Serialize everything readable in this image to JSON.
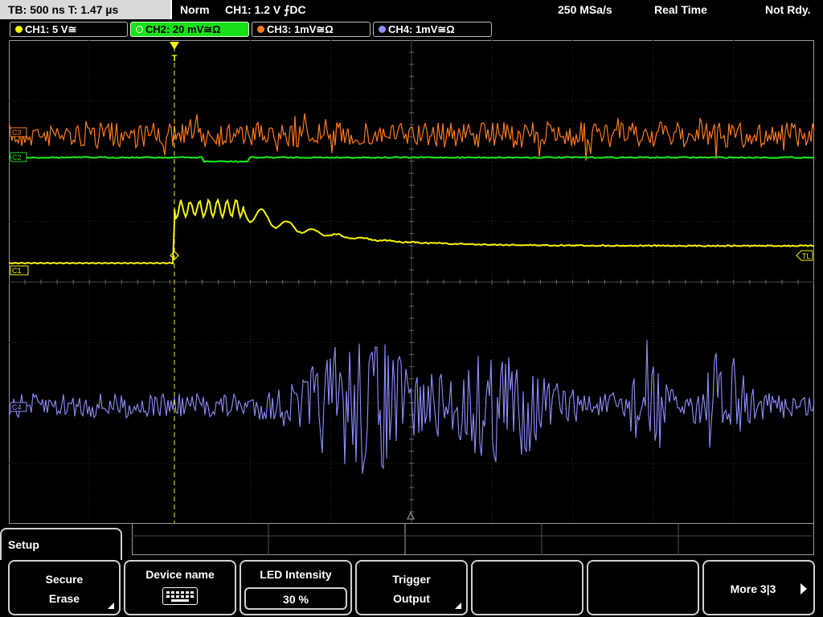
{
  "status": {
    "timebase": "TB: 500 ns   T: 1.47 µs",
    "mode": "Norm",
    "trigger": "CH1: 1.2 V ⨍DC",
    "sample_rate": "250 MSa/s",
    "acq_mode": "Real Time",
    "state": "Not Rdy."
  },
  "channels": [
    {
      "label": "CH1: 5 V≅",
      "color": "#f5f500"
    },
    {
      "label": "CH2: 20 mV≅Ω",
      "color": "#18e018"
    },
    {
      "label": "CH3: 1mV≅Ω",
      "color": "#ff7a1a"
    },
    {
      "label": "CH4: 1mV≅Ω",
      "color": "#8f8fff"
    }
  ],
  "markers": {
    "c3": "C3",
    "c2": "C2",
    "c1": "C1",
    "c4": "C4",
    "trigger_level": "TL",
    "trigger_pos": "T"
  },
  "menu": {
    "title": "Setup",
    "softkeys": [
      {
        "line1": "Secure",
        "line2": "Erase"
      },
      {
        "line1": "Device name",
        "icon": "keyboard-icon"
      },
      {
        "line1": "LED Intensity",
        "value": "30 %"
      },
      {
        "line1": "Trigger",
        "line2": "Output"
      },
      {
        "line1": ""
      },
      {
        "line1": ""
      },
      {
        "line1": "More 3|3"
      }
    ]
  }
}
